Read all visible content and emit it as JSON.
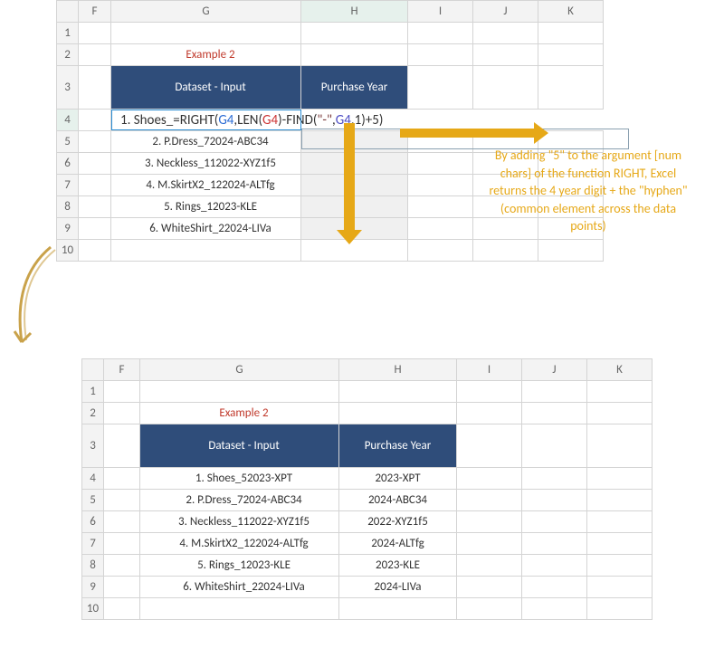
{
  "columns": [
    "F",
    "G",
    "H",
    "I",
    "J",
    "K"
  ],
  "rows_top": [
    "1",
    "2",
    "3",
    "4",
    "5",
    "6",
    "7",
    "8",
    "9",
    "10"
  ],
  "rows_bottom": [
    "1",
    "2",
    "3",
    "4",
    "5",
    "6",
    "7",
    "8",
    "9",
    "10"
  ],
  "example_title": "Example 2",
  "headers": {
    "dataset": "Dataset - Input",
    "year": "Purchase Year"
  },
  "formula_parts": {
    "prefix": "1. Shoes_",
    "eq": "=RIGHT(",
    "g4a": "G4",
    "comma1": ",LEN(",
    "g4b": "G4",
    "close1": ")-FIND(",
    "quote": "\"-\"",
    "comma2": ",",
    "g4c": "G4",
    "comma3": ",",
    "one": "1",
    "close2": ")+",
    "five": "5",
    "end": ")"
  },
  "top_dataset": [
    "2. P.Dress_72024-ABC34",
    "3. Neckless_112022-XYZ1f5",
    "4. M.SkirtX2_122024-ALTfg",
    "5. Rings_12023-KLE",
    "6. WhiteShirt_22024-LIVa"
  ],
  "annotation": "By adding \"5\" to the argument [num chars] of the function RIGHT, Excel returns the 4 year digit + the \"hyphen\" (common element across the data points)",
  "bottom_dataset": [
    {
      "input": "1. Shoes_52023-XPT",
      "year": "2023-XPT"
    },
    {
      "input": "2. P.Dress_72024-ABC34",
      "year": "2024-ABC34"
    },
    {
      "input": "3. Neckless_112022-XYZ1f5",
      "year": "2022-XYZ1f5"
    },
    {
      "input": "4. M.SkirtX2_122024-ALTfg",
      "year": "2024-ALTfg"
    },
    {
      "input": "5. Rings_12023-KLE",
      "year": "2023-KLE"
    },
    {
      "input": "6. WhiteShirt_22024-LIVa",
      "year": "2024-LIVa"
    }
  ]
}
